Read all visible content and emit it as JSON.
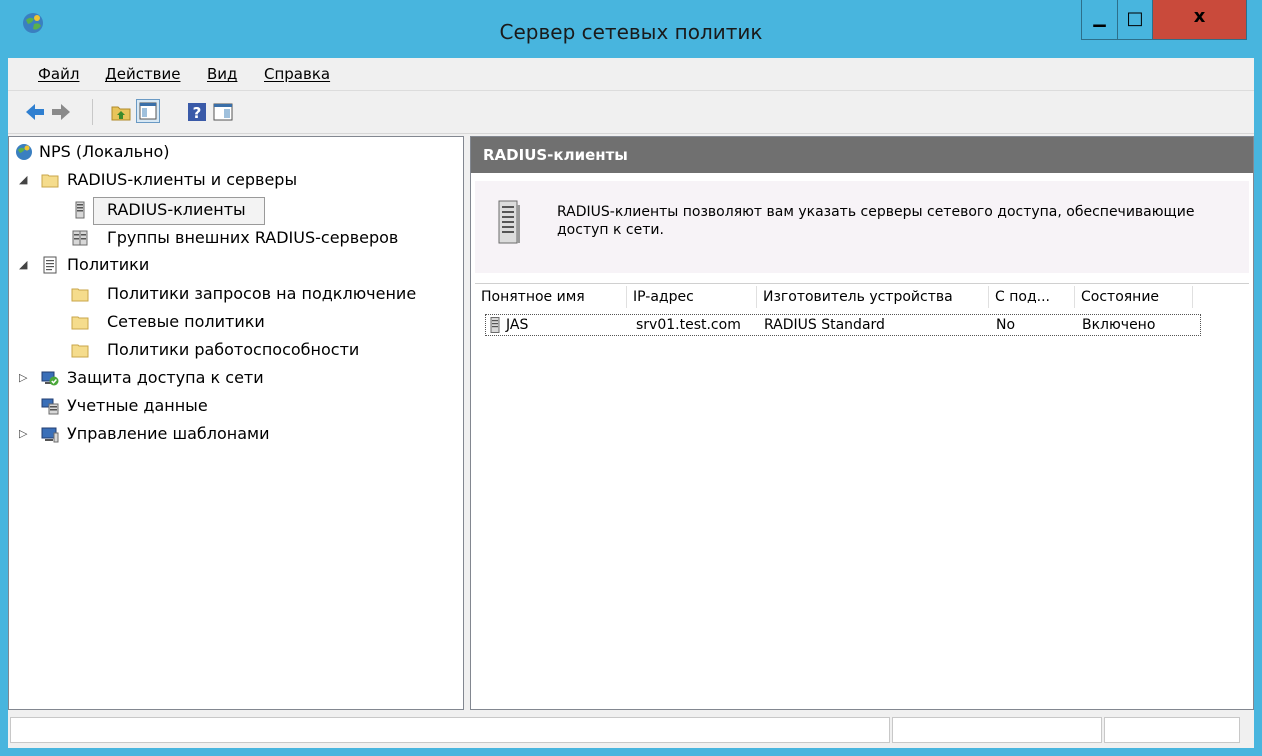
{
  "window": {
    "title": "Сервер сетевых политик",
    "controls": {
      "minimize": "▁",
      "maximize": "□",
      "close": "x"
    },
    "accent_color": "#48b5de",
    "close_color": "#c94a3b"
  },
  "menu": {
    "items": [
      {
        "label": "Файл"
      },
      {
        "label": "Действие"
      },
      {
        "label": "Вид"
      },
      {
        "label": "Справка"
      }
    ]
  },
  "toolbar": {
    "buttons": [
      {
        "icon": "back-arrow-icon"
      },
      {
        "icon": "forward-arrow-icon"
      },
      {
        "icon": "up-folder-icon"
      },
      {
        "icon": "show-hide-tree-icon"
      },
      {
        "icon": "help-icon"
      },
      {
        "icon": "action-pane-icon"
      }
    ]
  },
  "tree": {
    "root": {
      "label": "NPS (Локально)",
      "icon": "globe-icon"
    },
    "items": [
      {
        "label": "RADIUS-клиенты и серверы",
        "icon": "folder-icon",
        "expanded": true
      },
      {
        "label": "RADIUS-клиенты",
        "icon": "server-icon",
        "selected": true
      },
      {
        "label": "Группы внешних RADIUS-серверов",
        "icon": "server-group-icon"
      },
      {
        "label": "Политики",
        "icon": "policy-icon",
        "expanded": true
      },
      {
        "label": "Политики запросов на подключение",
        "icon": "folder-icon"
      },
      {
        "label": "Сетевые политики",
        "icon": "folder-icon"
      },
      {
        "label": "Политики работоспособности",
        "icon": "folder-icon"
      },
      {
        "label": "Защита доступа к сети",
        "icon": "network-protection-icon",
        "expanded": false
      },
      {
        "label": "Учетные данные",
        "icon": "accounting-icon"
      },
      {
        "label": "Управление шаблонами",
        "icon": "templates-icon",
        "expanded": false
      }
    ]
  },
  "detail": {
    "header": "RADIUS-клиенты",
    "description": "RADIUS-клиенты позволяют вам указать серверы сетевого доступа, обеспечивающие доступ к сети.",
    "columns": [
      "Понятное имя",
      "IP-адрес",
      "Изготовитель устройства",
      "С под...",
      "Состояние"
    ],
    "rows": [
      {
        "name": "JAS",
        "ip": "srv01.test.com",
        "vendor": "RADIUS Standard",
        "nap": "No",
        "status": "Включено"
      }
    ]
  }
}
